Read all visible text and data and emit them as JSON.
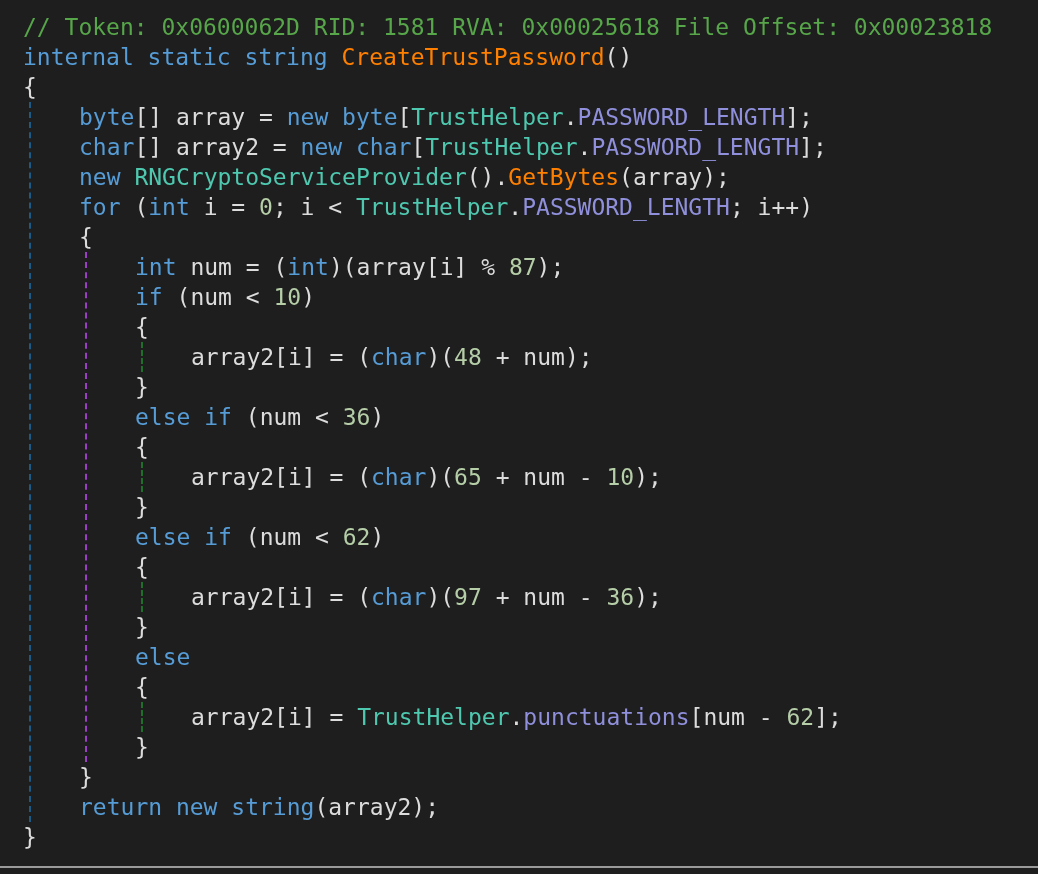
{
  "editor": {
    "lines": [
      {
        "tokens": [
          {
            "text": "// Token: 0x0600062D RID: 1581 RVA: 0x00025618 File Offset: 0x00023818",
            "kind": "comment"
          }
        ]
      },
      {
        "tokens": [
          {
            "text": "internal static string ",
            "kind": "keyword"
          },
          {
            "text": "CreateTrustPassword",
            "kind": "method"
          },
          {
            "text": "()",
            "kind": "plain"
          }
        ]
      },
      {
        "tokens": [
          {
            "text": "{",
            "kind": "plain"
          }
        ]
      },
      {
        "children": [
          {
            "tokens": [
              {
                "text": "byte",
                "kind": "keyword"
              },
              {
                "text": "[] array = ",
                "kind": "plain"
              },
              {
                "text": "new byte",
                "kind": "keyword"
              },
              {
                "text": "[",
                "kind": "plain"
              },
              {
                "text": "TrustHelper",
                "kind": "type"
              },
              {
                "text": ".",
                "kind": "plain"
              },
              {
                "text": "PASSWORD_LENGTH",
                "kind": "field"
              },
              {
                "text": "];",
                "kind": "plain"
              }
            ]
          },
          {
            "tokens": [
              {
                "text": "char",
                "kind": "keyword"
              },
              {
                "text": "[] array2 = ",
                "kind": "plain"
              },
              {
                "text": "new char",
                "kind": "keyword"
              },
              {
                "text": "[",
                "kind": "plain"
              },
              {
                "text": "TrustHelper",
                "kind": "type"
              },
              {
                "text": ".",
                "kind": "plain"
              },
              {
                "text": "PASSWORD_LENGTH",
                "kind": "field"
              },
              {
                "text": "];",
                "kind": "plain"
              }
            ]
          },
          {
            "tokens": [
              {
                "text": "new ",
                "kind": "keyword"
              },
              {
                "text": "RNGCryptoServiceProvider",
                "kind": "type"
              },
              {
                "text": "().",
                "kind": "plain"
              },
              {
                "text": "GetBytes",
                "kind": "method"
              },
              {
                "text": "(array);",
                "kind": "plain"
              }
            ]
          },
          {
            "tokens": [
              {
                "text": "for",
                "kind": "keyword"
              },
              {
                "text": " (",
                "kind": "plain"
              },
              {
                "text": "int",
                "kind": "keyword"
              },
              {
                "text": " i = ",
                "kind": "plain"
              },
              {
                "text": "0",
                "kind": "number"
              },
              {
                "text": "; i < ",
                "kind": "plain"
              },
              {
                "text": "TrustHelper",
                "kind": "type"
              },
              {
                "text": ".",
                "kind": "plain"
              },
              {
                "text": "PASSWORD_LENGTH",
                "kind": "field"
              },
              {
                "text": "; i++)",
                "kind": "plain"
              }
            ]
          },
          {
            "tokens": [
              {
                "text": "{",
                "kind": "plain"
              }
            ]
          },
          {
            "children": [
              {
                "tokens": [
                  {
                    "text": "int",
                    "kind": "keyword"
                  },
                  {
                    "text": " num = (",
                    "kind": "plain"
                  },
                  {
                    "text": "int",
                    "kind": "keyword"
                  },
                  {
                    "text": ")(array[i] % ",
                    "kind": "plain"
                  },
                  {
                    "text": "87",
                    "kind": "number"
                  },
                  {
                    "text": ");",
                    "kind": "plain"
                  }
                ]
              },
              {
                "tokens": [
                  {
                    "text": "if",
                    "kind": "keyword"
                  },
                  {
                    "text": " (num < ",
                    "kind": "plain"
                  },
                  {
                    "text": "10",
                    "kind": "number"
                  },
                  {
                    "text": ")",
                    "kind": "plain"
                  }
                ]
              },
              {
                "tokens": [
                  {
                    "text": "{",
                    "kind": "plain"
                  }
                ]
              },
              {
                "children": [
                  {
                    "tokens": [
                      {
                        "text": "array2[i] = (",
                        "kind": "plain"
                      },
                      {
                        "text": "char",
                        "kind": "keyword"
                      },
                      {
                        "text": ")(",
                        "kind": "plain"
                      },
                      {
                        "text": "48",
                        "kind": "number"
                      },
                      {
                        "text": " + num);",
                        "kind": "plain"
                      }
                    ]
                  }
                ]
              },
              {
                "tokens": [
                  {
                    "text": "}",
                    "kind": "plain"
                  }
                ]
              },
              {
                "tokens": [
                  {
                    "text": "else if",
                    "kind": "keyword"
                  },
                  {
                    "text": " (num < ",
                    "kind": "plain"
                  },
                  {
                    "text": "36",
                    "kind": "number"
                  },
                  {
                    "text": ")",
                    "kind": "plain"
                  }
                ]
              },
              {
                "tokens": [
                  {
                    "text": "{",
                    "kind": "plain"
                  }
                ]
              },
              {
                "children": [
                  {
                    "tokens": [
                      {
                        "text": "array2[i] = (",
                        "kind": "plain"
                      },
                      {
                        "text": "char",
                        "kind": "keyword"
                      },
                      {
                        "text": ")(",
                        "kind": "plain"
                      },
                      {
                        "text": "65",
                        "kind": "number"
                      },
                      {
                        "text": " + num - ",
                        "kind": "plain"
                      },
                      {
                        "text": "10",
                        "kind": "number"
                      },
                      {
                        "text": ");",
                        "kind": "plain"
                      }
                    ]
                  }
                ]
              },
              {
                "tokens": [
                  {
                    "text": "}",
                    "kind": "plain"
                  }
                ]
              },
              {
                "tokens": [
                  {
                    "text": "else if",
                    "kind": "keyword"
                  },
                  {
                    "text": " (num < ",
                    "kind": "plain"
                  },
                  {
                    "text": "62",
                    "kind": "number"
                  },
                  {
                    "text": ")",
                    "kind": "plain"
                  }
                ]
              },
              {
                "tokens": [
                  {
                    "text": "{",
                    "kind": "plain"
                  }
                ]
              },
              {
                "children": [
                  {
                    "tokens": [
                      {
                        "text": "array2[i] = (",
                        "kind": "plain"
                      },
                      {
                        "text": "char",
                        "kind": "keyword"
                      },
                      {
                        "text": ")(",
                        "kind": "plain"
                      },
                      {
                        "text": "97",
                        "kind": "number"
                      },
                      {
                        "text": " + num - ",
                        "kind": "plain"
                      },
                      {
                        "text": "36",
                        "kind": "number"
                      },
                      {
                        "text": ");",
                        "kind": "plain"
                      }
                    ]
                  }
                ]
              },
              {
                "tokens": [
                  {
                    "text": "}",
                    "kind": "plain"
                  }
                ]
              },
              {
                "tokens": [
                  {
                    "text": "else",
                    "kind": "keyword"
                  }
                ]
              },
              {
                "tokens": [
                  {
                    "text": "{",
                    "kind": "plain"
                  }
                ]
              },
              {
                "children": [
                  {
                    "tokens": [
                      {
                        "text": "array2[i] = ",
                        "kind": "plain"
                      },
                      {
                        "text": "TrustHelper",
                        "kind": "type"
                      },
                      {
                        "text": ".",
                        "kind": "plain"
                      },
                      {
                        "text": "punctuations",
                        "kind": "field"
                      },
                      {
                        "text": "[num - ",
                        "kind": "plain"
                      },
                      {
                        "text": "62",
                        "kind": "number"
                      },
                      {
                        "text": "];",
                        "kind": "plain"
                      }
                    ]
                  }
                ]
              },
              {
                "tokens": [
                  {
                    "text": "}",
                    "kind": "plain"
                  }
                ]
              }
            ]
          },
          {
            "tokens": [
              {
                "text": "}",
                "kind": "plain"
              }
            ]
          },
          {
            "tokens": [
              {
                "text": "return new string",
                "kind": "keyword"
              },
              {
                "text": "(array2);",
                "kind": "plain"
              }
            ]
          }
        ]
      },
      {
        "tokens": [
          {
            "text": "}",
            "kind": "plain"
          }
        ]
      }
    ]
  }
}
